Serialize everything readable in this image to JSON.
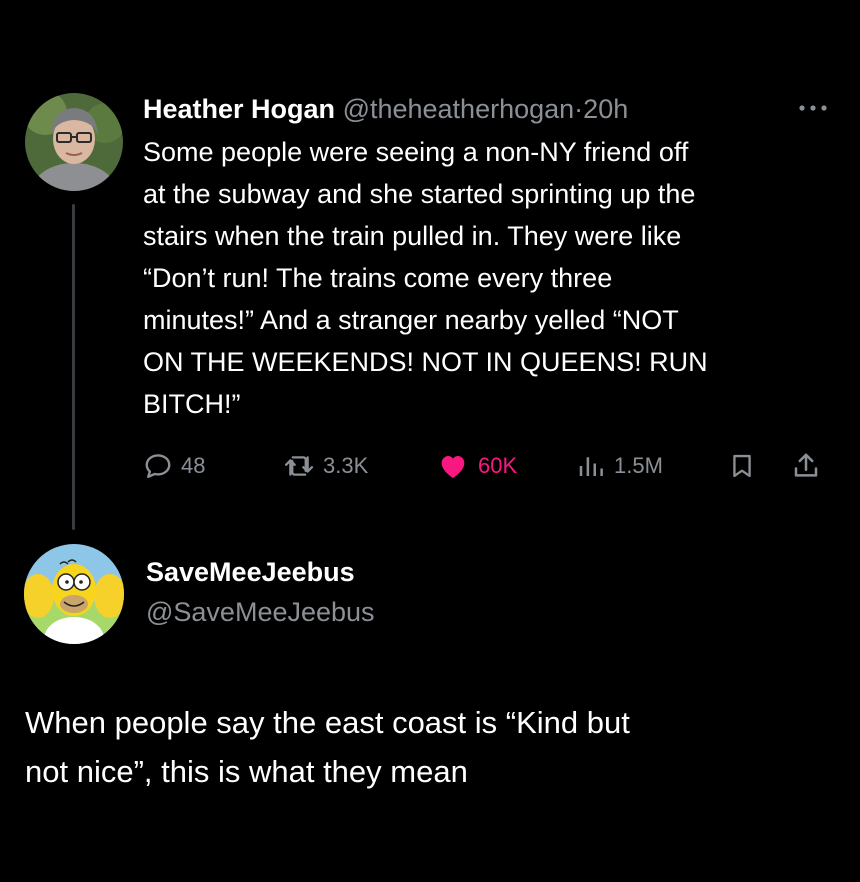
{
  "tweet": {
    "author_name": "Heather Hogan",
    "author_handle": "@theheatherhogan",
    "separator": "·",
    "timestamp": "20h",
    "avatar_icon": "profile-photo-avatar",
    "more_icon": "more-options-icon",
    "text": "Some people were seeing a non-NY friend off\nat the subway and she started sprinting up the\nstairs when the train pulled in. They were like\n“Don’t run! The trains come every three\nminutes!” And a stranger nearby yelled “NOT\nON THE WEEKENDS! NOT IN QUEENS! RUN\nBITCH!”",
    "actions": {
      "replies": "48",
      "retweets": "3.3K",
      "likes": "60K",
      "views": "1.5M"
    },
    "colors": {
      "like": "#f91880",
      "muted": "#8b9096",
      "thread_line": "#3a3d40"
    }
  },
  "reply": {
    "author_name": "SaveMeeJeebus",
    "author_handle": "@SaveMeeJeebus",
    "avatar_icon": "cartoon-character-avatar",
    "text": "When people say the east coast is  “Kind but\nnot nice”, this is what they mean"
  }
}
